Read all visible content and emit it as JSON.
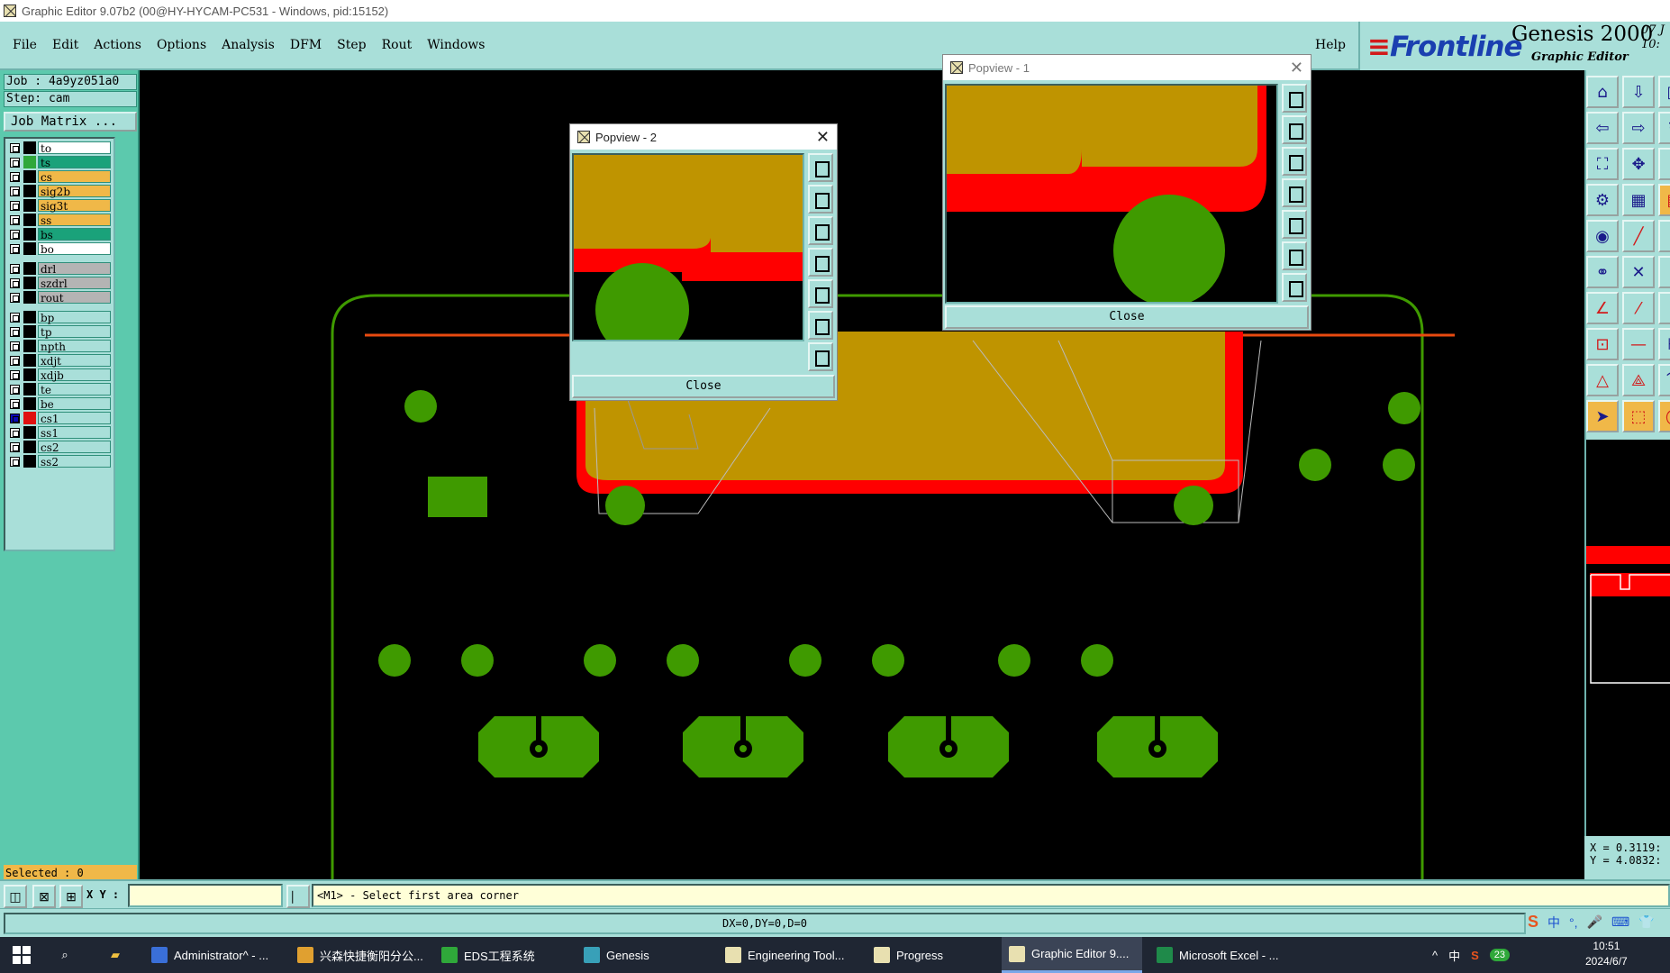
{
  "window": {
    "title": "Graphic Editor 9.07b2 (00@HY-HYCAM-PC531 - Windows, pid:15152)"
  },
  "menu": {
    "items": [
      "File",
      "Edit",
      "Actions",
      "Options",
      "Analysis",
      "DFM",
      "Step",
      "Rout",
      "Windows"
    ],
    "help": "Help"
  },
  "brand": {
    "logo": "Frontline",
    "product": "Genesis 2000",
    "subtitle": "Graphic Editor",
    "clock": "07 J\n10:"
  },
  "left_panel": {
    "job": "Job : 4a9yz051a0",
    "step": "Step: cam",
    "job_matrix": "Job Matrix ...",
    "selected": "Selected : 0",
    "layers": [
      {
        "name": "to",
        "swatch": "#000000",
        "bg": "#ffffff",
        "checked": false,
        "group_start": true
      },
      {
        "name": "ts",
        "swatch": "#2fa83a",
        "bg": "#1aa27a",
        "checked": false
      },
      {
        "name": "cs",
        "swatch": "#000000",
        "bg": "#f0b848",
        "checked": false
      },
      {
        "name": "sig2b",
        "swatch": "#000000",
        "bg": "#f0b848",
        "checked": false
      },
      {
        "name": "sig3t",
        "swatch": "#000000",
        "bg": "#f0b848",
        "checked": false
      },
      {
        "name": "ss",
        "swatch": "#000000",
        "bg": "#f0b848",
        "checked": false
      },
      {
        "name": "bs",
        "swatch": "#000000",
        "bg": "#1aa27a",
        "checked": false
      },
      {
        "name": "bo",
        "swatch": "#000000",
        "bg": "#ffffff",
        "checked": false
      },
      {
        "name": "drl",
        "swatch": "#000000",
        "bg": "#b4b4b4",
        "checked": false,
        "group_start": true
      },
      {
        "name": "szdrl",
        "swatch": "#000000",
        "bg": "#b4b4b4",
        "checked": false
      },
      {
        "name": "rout",
        "swatch": "#000000",
        "bg": "#b4b4b4",
        "checked": false
      },
      {
        "name": "bp",
        "swatch": "#000000",
        "bg": "#a9dfd9",
        "checked": false,
        "group_start": true
      },
      {
        "name": "tp",
        "swatch": "#000000",
        "bg": "#a9dfd9",
        "checked": false
      },
      {
        "name": "npth",
        "swatch": "#000000",
        "bg": "#a9dfd9",
        "checked": false
      },
      {
        "name": "xdjt",
        "swatch": "#000000",
        "bg": "#a9dfd9",
        "checked": false
      },
      {
        "name": "xdjb",
        "swatch": "#000000",
        "bg": "#a9dfd9",
        "checked": false
      },
      {
        "name": "te",
        "swatch": "#000000",
        "bg": "#a9dfd9",
        "checked": false
      },
      {
        "name": "be",
        "swatch": "#000000",
        "bg": "#a9dfd9",
        "checked": false
      },
      {
        "name": "cs1",
        "swatch": "#e01010",
        "bg": "#a9dfd9",
        "checked": true
      },
      {
        "name": "ss1",
        "swatch": "#000000",
        "bg": "#a9dfd9",
        "checked": false
      },
      {
        "name": "cs2",
        "swatch": "#000000",
        "bg": "#a9dfd9",
        "checked": false
      },
      {
        "name": "ss2",
        "swatch": "#000000",
        "bg": "#a9dfd9",
        "checked": false
      }
    ]
  },
  "popview1": {
    "title": "Popview - 1",
    "close_label": "Close"
  },
  "popview2": {
    "title": "Popview - 2",
    "close_label": "Close"
  },
  "coords": {
    "x": "X = 0.3119:",
    "y": "Y = 4.0832:"
  },
  "cmd": {
    "xy_label": "X Y :",
    "xy_value": "",
    "prompt": "<M1> - Select first area corner",
    "status": "DX=0,DY=0,D=0"
  },
  "ime": [
    "S",
    "中",
    "°,",
    "🎤",
    "⌨",
    "👕"
  ],
  "taskbar": {
    "tasks": [
      {
        "label": "Administrator^ - ...",
        "color": "#3a6fd8"
      },
      {
        "label": "兴森快捷衡阳分公...",
        "color": "#e0a030"
      },
      {
        "label": "EDS工程系统",
        "color": "#2fa83a"
      },
      {
        "label": "Genesis",
        "color": "#38a0b8"
      },
      {
        "label": "Engineering Tool...",
        "color": "#e8e0b0"
      },
      {
        "label": "Progress",
        "color": "#e8e0b0"
      },
      {
        "label": "Graphic Editor 9....",
        "color": "#e8e0b0",
        "active": true
      },
      {
        "label": "Microsoft Excel - ...",
        "color": "#1f8a4a"
      }
    ],
    "tray": [
      "^",
      "中",
      "S",
      "23"
    ],
    "time": "10:51",
    "date": "2024/6/7"
  },
  "colors": {
    "panel": "#a9dfd9",
    "left_panel": "#5cc9ad",
    "copper": "#bf9400",
    "outline_red": "#ff0000",
    "pad_green": "#3f9a00"
  }
}
